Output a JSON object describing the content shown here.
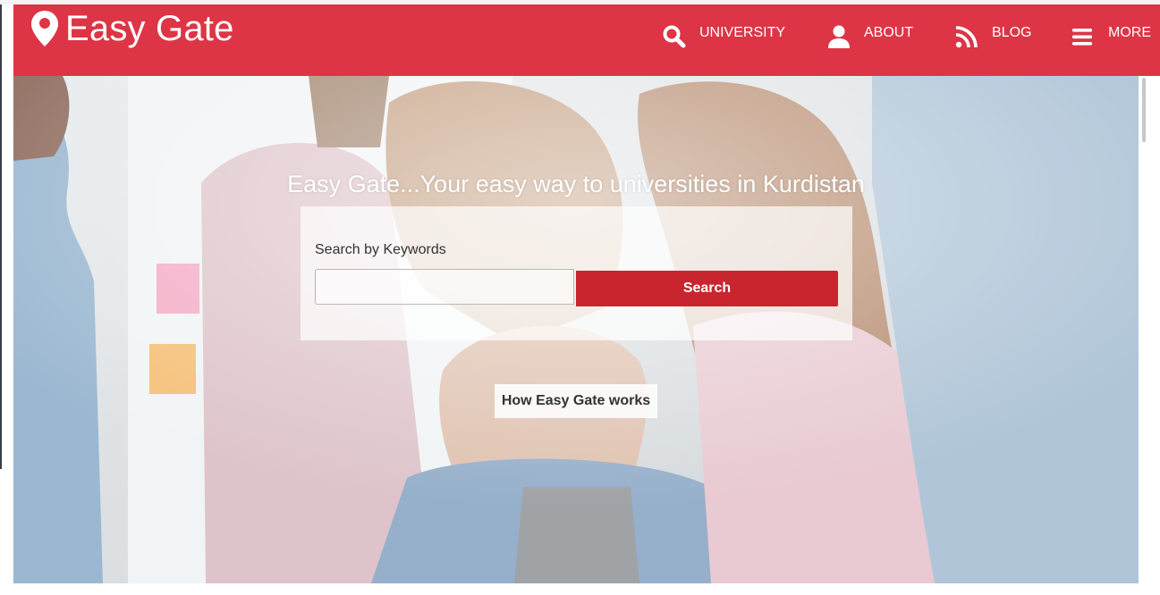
{
  "brand": {
    "name": "Easy Gate",
    "icon": "map-pin-icon"
  },
  "nav": {
    "items": [
      {
        "label": "UNIVERSITY",
        "icon": "search-icon"
      },
      {
        "label": "ABOUT",
        "icon": "user-icon"
      },
      {
        "label": "BLOG",
        "icon": "rss-icon"
      },
      {
        "label": "MORE",
        "icon": "menu-icon"
      }
    ]
  },
  "hero": {
    "title": "Easy Gate...Your easy way to universities in Kurdistan",
    "search": {
      "label": "Search by Keywords",
      "value": "",
      "placeholder": "",
      "button_label": "Search"
    },
    "how_button_label": "How Easy Gate works"
  },
  "colors": {
    "brand_red": "#dd3545",
    "button_red": "#c9252f",
    "white": "#ffffff"
  }
}
